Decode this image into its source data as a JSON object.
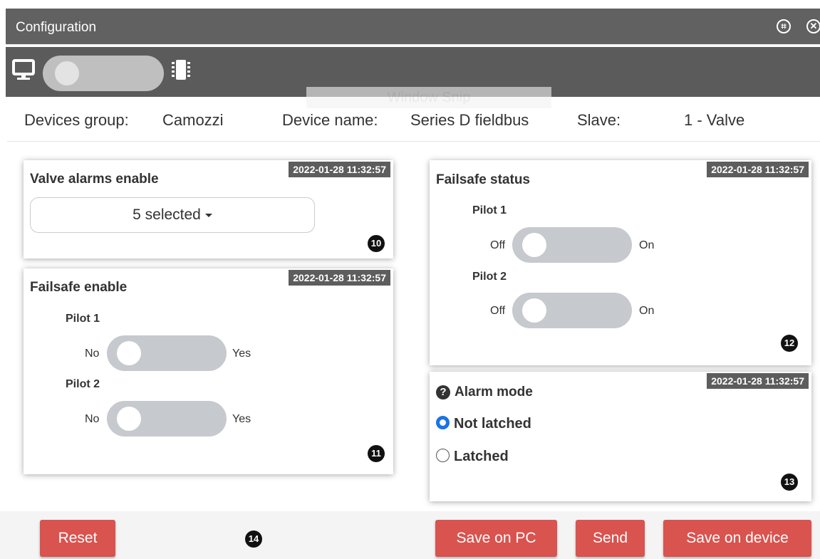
{
  "window": {
    "title": "Configuration",
    "restore_glyph": "⌗",
    "close_glyph": "✕"
  },
  "toolbar": {
    "left_icon": "monitor-icon",
    "right_icon": "chip-icon"
  },
  "overlay": {
    "text": "Window Snip"
  },
  "device_info": {
    "group_label": "Devices group:",
    "group_value": "Camozzi",
    "name_label": "Device name:",
    "name_value": "Series D fieldbus",
    "slave_label": "Slave:",
    "slave_value": "1 - Valve"
  },
  "cards": {
    "valve_alarms": {
      "title": "Valve alarms enable",
      "timestamp": "2022-01-28 11:32:57",
      "dropdown_value": "5 selected",
      "badge": "10"
    },
    "failsafe_enable": {
      "title": "Failsafe enable",
      "timestamp": "2022-01-28 11:32:57",
      "badge": "11",
      "pilots": [
        {
          "label": "Pilot 1",
          "off_text": "No",
          "on_text": "Yes",
          "state": false
        },
        {
          "label": "Pilot 2",
          "off_text": "No",
          "on_text": "Yes",
          "state": false
        }
      ]
    },
    "failsafe_status": {
      "title": "Failsafe status",
      "timestamp": "2022-01-28 11:32:57",
      "badge": "12",
      "pilots": [
        {
          "label": "Pilot 1",
          "off_text": "Off",
          "on_text": "On",
          "state": false
        },
        {
          "label": "Pilot 2",
          "off_text": "Off",
          "on_text": "On",
          "state": false
        }
      ]
    },
    "alarm_mode": {
      "title": "Alarm mode",
      "timestamp": "2022-01-28 11:32:57",
      "badge": "13",
      "options": [
        {
          "label": "Not latched",
          "selected": true
        },
        {
          "label": "Latched",
          "selected": false
        }
      ]
    }
  },
  "footer": {
    "reset_label": "Reset",
    "badge": "14",
    "save_pc_label": "Save on PC",
    "send_label": "Send",
    "save_device_label": "Save on device"
  },
  "colors": {
    "titlebar": "#616161",
    "toolbar": "#5b5b5b",
    "button": "#d9534f",
    "switch_track": "#c6c9cd",
    "radio_selected": "#1a73e8"
  }
}
